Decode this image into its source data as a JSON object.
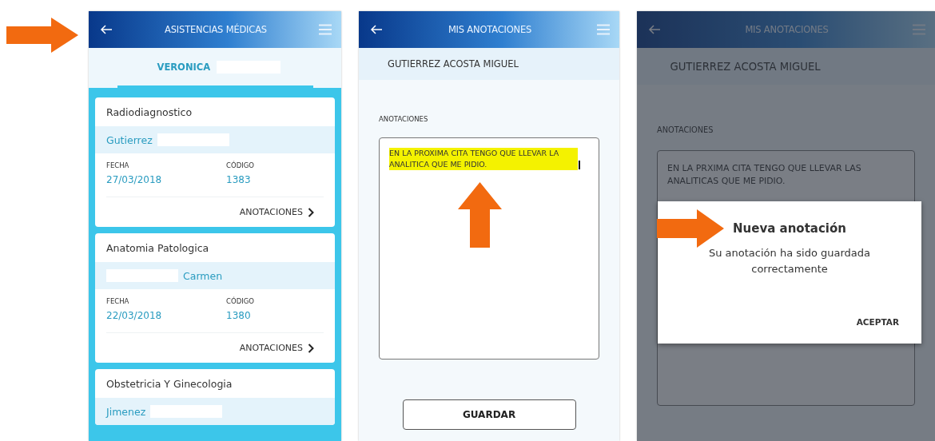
{
  "screens": [
    {
      "kind": "list",
      "header": {
        "title": "ASISTENCIAS MÉDICAS"
      },
      "tabs": [
        {
          "label": "VERONICA",
          "selected": true,
          "redacted_after": true
        }
      ],
      "cards": [
        {
          "title": "Radiodiagnostico",
          "doctor": {
            "text": "Gutierrez",
            "redacted_before": false,
            "redacted_after": true
          },
          "fields": [
            {
              "label": "FECHA",
              "value": "27/03/2018"
            },
            {
              "label": "CÓDIGO",
              "value": "1383"
            }
          ],
          "link": "ANOTACIONES"
        },
        {
          "title": "Anatomia Patologica",
          "doctor": {
            "text": "Carmen",
            "redacted_before": true,
            "redacted_after": false
          },
          "fields": [
            {
              "label": "FECHA",
              "value": "22/03/2018"
            },
            {
              "label": "CÓDIGO",
              "value": "1380"
            }
          ],
          "link": "ANOTACIONES"
        },
        {
          "title": "Obstetricia Y Ginecologia",
          "doctor": {
            "text": "Jimenez",
            "redacted_before": false,
            "redacted_after": true
          }
        }
      ]
    },
    {
      "kind": "editor",
      "header": {
        "title": "MIS ANOTACIONES"
      },
      "patient": "GUTIERREZ ACOSTA MIGUEL",
      "label": "ANOTACIONES",
      "note": {
        "text": "EN LA PROXIMA CITA TENGO QUE LLEVAR LA ANALITICA QUE ME PIDIO.",
        "highlighted": true
      },
      "button": "GUARDAR"
    },
    {
      "kind": "dialog",
      "header": {
        "title": "MIS ANOTACIONES"
      },
      "patient": "GUTIERREZ ACOSTA MIGUEL",
      "label": "ANOTACIONES",
      "note": {
        "text": "EN LA PRXIMA CITA TENGO QUE LLEVAR LAS ANALITICAS QUE ME PIDIO.",
        "highlighted": false
      },
      "dialog": {
        "title": "Nueva anotación",
        "message": "Su anotación ha sido guardada correctamente",
        "action": "ACEPTAR"
      }
    }
  ]
}
